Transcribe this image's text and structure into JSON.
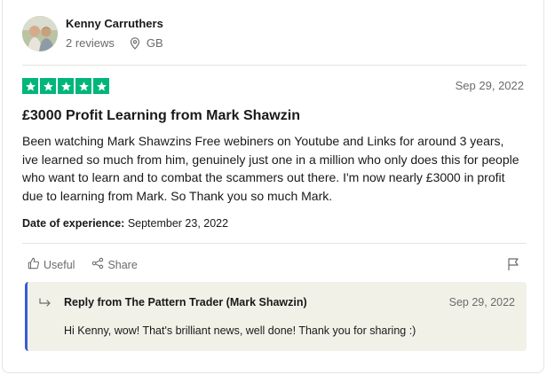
{
  "reviewer": {
    "name": "Kenny Carruthers",
    "reviews": "2 reviews",
    "country": "GB"
  },
  "review": {
    "rating": 5,
    "star_color": "#00b67a",
    "date": "Sep 29, 2022",
    "title": "£3000 Profit Learning from Mark Shawzin",
    "body": "Been watching Mark Shawzins Free webiners on Youtube and Links for around 3 years, ive learned so much from him, genuinely just one in a million who only does this for people who want to learn and to combat the scammers out there. I'm now nearly £3000 in profit due to learning from Mark. So Thank you so much Mark.",
    "experience_label": "Date of experience:",
    "experience_date": "September 23, 2022"
  },
  "actions": {
    "useful_label": "Useful",
    "share_label": "Share",
    "icons": [
      "thumbs-up-icon",
      "share-icon",
      "flag-icon"
    ]
  },
  "reply": {
    "from": "Reply from The Pattern Trader (Mark Shawzin)",
    "date": "Sep 29, 2022",
    "text": "Hi Kenny, wow! That's brilliant news, well done! Thank you for sharing :)",
    "accent_color": "#3b5bd8"
  }
}
